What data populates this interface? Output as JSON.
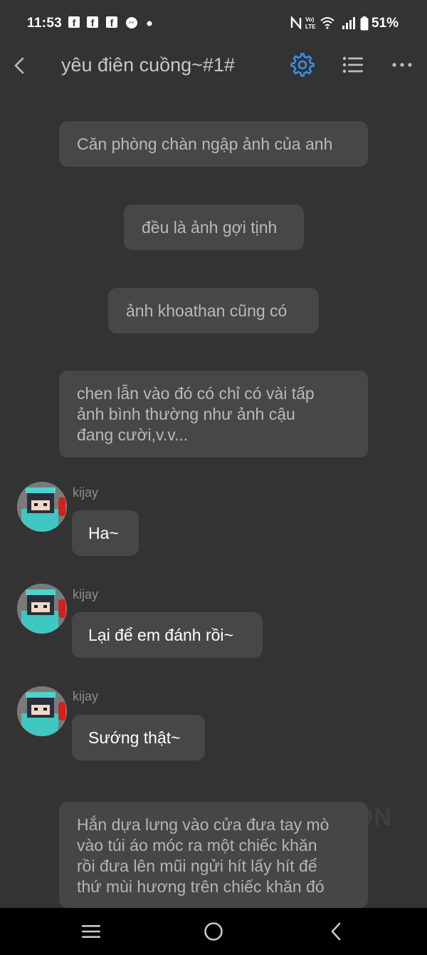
{
  "status_bar": {
    "time": "11:53",
    "battery": "51%",
    "notification_icons": [
      "facebook-icon",
      "facebook-icon",
      "facebook-icon",
      "messenger-icon",
      "dot-icon"
    ],
    "system_icons": [
      "nfc-icon",
      "volte-icon",
      "wifi-icon",
      "signal-icon",
      "battery-icon"
    ]
  },
  "header": {
    "title": "yêu điên cuồng~#1#",
    "accent_color": "#3b8fe8"
  },
  "messages": [
    {
      "type": "narration",
      "text": "Căn phòng chàn ngập ảnh của anh"
    },
    {
      "type": "narration",
      "text": "đều là ảnh gợi tịnh"
    },
    {
      "type": "narration",
      "text": "ảnh khoathan cũng có"
    },
    {
      "type": "narration",
      "lines": [
        "chen lẫn vào đó có chỉ có vài tấp",
        "ảnh bình thường như ảnh cậu",
        "đang cười,v.v..."
      ]
    },
    {
      "type": "message",
      "sender": "kijay",
      "text": "Ha~"
    },
    {
      "type": "message",
      "sender": "kijay",
      "text": "Lại để em đánh rồi~"
    },
    {
      "type": "message",
      "sender": "kijay",
      "text": "Sướng thật~"
    },
    {
      "type": "narration",
      "lines": [
        "Hắn dựa lưng vào cửa đưa tay mò",
        "vào túi áo móc ra một chiếc khăn",
        "rồi đưa lên mũi ngửi hít lấy hít để",
        "thứ mùi hương trên chiếc khăn đó"
      ]
    }
  ],
  "watermark": "ON",
  "nav_bar": {
    "icons": [
      "recent-apps-icon",
      "home-icon",
      "back-icon"
    ]
  }
}
